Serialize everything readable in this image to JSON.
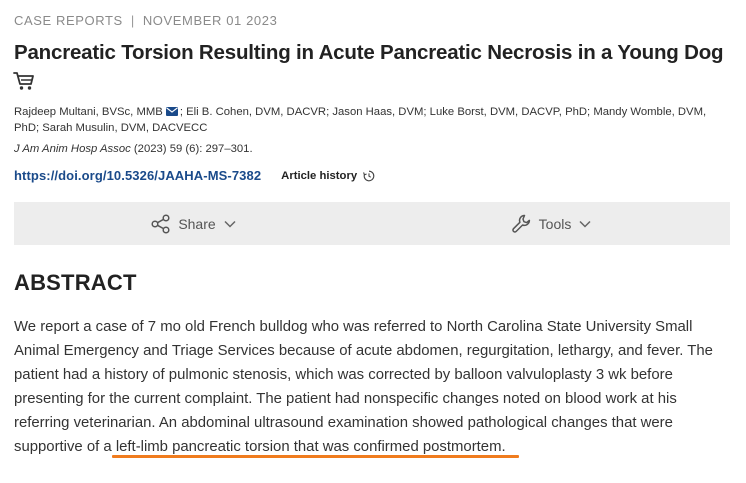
{
  "header": {
    "section": "CASE REPORTS",
    "separator": "|",
    "date": "NOVEMBER 01 2023"
  },
  "title": "Pancreatic Torsion Resulting in Acute Pancreatic Necrosis in a Young Dog",
  "authors": {
    "first": "Rajdeep Multani, BVSc, MMB",
    "rest": "; Eli B. Cohen, DVM, DACVR; Jason Haas, DVM; Luke Borst, DVM, DACVP, PhD; Mandy Womble, DVM, PhD; Sarah Musulin, DVM, DACVECC"
  },
  "citation": {
    "journal": "J Am Anim Hosp Assoc",
    "details": " (2023) 59 (6): 297–301."
  },
  "doi": "https://doi.org/10.5326/JAAHA-MS-7382",
  "article_history_label": "Article history",
  "toolbar": {
    "share_label": "Share",
    "tools_label": "Tools"
  },
  "abstract": {
    "heading": "ABSTRACT",
    "text_before": "We report a case of 7 mo old French bulldog who was referred to North Carolina State University Small Animal Emergency and Triage Services because of acute abdomen, regurgitation, lethargy, and fever. The patient had a history of pulmonic stenosis, which was corrected by balloon valvuloplasty 3 wk before presenting for the current complaint. The patient had nonspecific changes noted on blood work at his referring veterinarian. An abdominal ultrasound examination showed pathological changes that were supportive of a ",
    "text_highlight": "left-limb pancreatic torsion that was confirmed postmortem."
  },
  "colors": {
    "link": "#1a4a8a",
    "highlight_underline": "#f07c1e",
    "toolbar_bg": "#ededed"
  },
  "icons": [
    "cart-icon",
    "mail-icon",
    "history-icon",
    "share-icon",
    "chevron-down-icon",
    "wrench-icon"
  ]
}
